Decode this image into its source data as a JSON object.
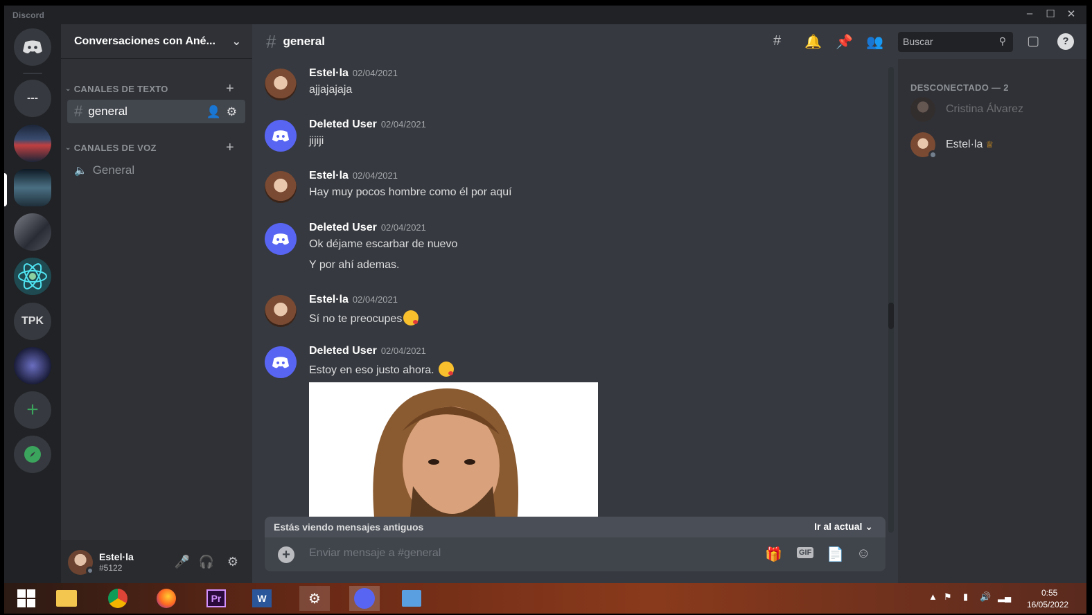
{
  "window": {
    "app_name": "Discord",
    "minimize": "–",
    "maximize": "☐",
    "close": "✕"
  },
  "guilds": [
    {
      "label": ""
    },
    {
      "label": "---"
    },
    {
      "label": ""
    },
    {
      "label": ""
    },
    {
      "label": ""
    },
    {
      "label": ""
    },
    {
      "label": "TPK"
    },
    {
      "label": ""
    }
  ],
  "server": {
    "name": "Conversaciones con Ané..."
  },
  "categories": {
    "text": "CANALES DE TEXTO",
    "voice": "CANALES DE VOZ"
  },
  "channels": {
    "text": [
      {
        "name": "general"
      }
    ],
    "voice": [
      {
        "name": "General"
      }
    ]
  },
  "current_channel": "general",
  "search": {
    "placeholder": "Buscar"
  },
  "messages": [
    {
      "author": "Estel·la",
      "date": "02/04/2021",
      "lines": [
        "ajjajajaja"
      ]
    },
    {
      "author": "Deleted User",
      "date": "02/04/2021",
      "lines": [
        "jijiji"
      ]
    },
    {
      "author": "Estel·la",
      "date": "02/04/2021",
      "lines": [
        "Hay muy pocos hombre como él por aquí"
      ]
    },
    {
      "author": "Deleted User",
      "date": "02/04/2021",
      "lines": [
        "Ok   déjame escarbar de nuevo",
        "Y por  ahí ademas."
      ]
    },
    {
      "author": "Estel·la",
      "date": "02/04/2021",
      "lines": [
        "Sí no te preocupes"
      ]
    },
    {
      "author": "Deleted User",
      "date": "02/04/2021",
      "lines": [
        "Estoy en eso justo ahora. "
      ]
    }
  ],
  "old_messages": {
    "notice": "Estás viendo mensajes antiguos",
    "jump": "Ir al actual  ⌄"
  },
  "composer": {
    "placeholder": "Enviar mensaje a #general",
    "gif": "GIF"
  },
  "members": {
    "header": "DESCONECTADO — 2",
    "list": [
      {
        "name": "Cristina Álvarez"
      },
      {
        "name": "Estel·la"
      }
    ]
  },
  "user": {
    "name": "Estel·la",
    "tag": "#5122"
  },
  "taskbar": {
    "time": "0:55",
    "date": "16/05/2022",
    "premiere": "Pr",
    "word": "W"
  },
  "colors": {
    "blurple": "#5865f2",
    "bg_chat": "#36393f",
    "bg_sidebar": "#2f3136",
    "bg_rail": "#202225"
  }
}
